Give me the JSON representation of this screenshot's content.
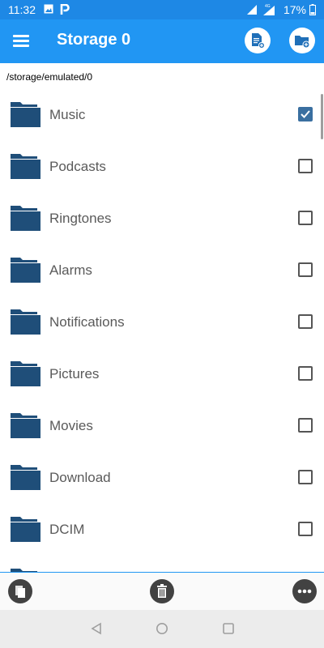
{
  "status_bar": {
    "time": "11:32",
    "battery_percent": "17%",
    "icons": [
      "image-icon",
      "p-app-icon",
      "wifi-icon",
      "cell-signal-icon",
      "battery-charging-icon"
    ]
  },
  "app_bar": {
    "title": "Storage 0",
    "menu_icon": "hamburger-icon",
    "actions": [
      "new-file-icon",
      "new-folder-icon"
    ],
    "color": "#2196f3"
  },
  "path": "/storage/emulated/0",
  "folders": [
    {
      "name": "Music",
      "checked": true
    },
    {
      "name": "Podcasts",
      "checked": false
    },
    {
      "name": "Ringtones",
      "checked": false
    },
    {
      "name": "Alarms",
      "checked": false
    },
    {
      "name": "Notifications",
      "checked": false
    },
    {
      "name": "Pictures",
      "checked": false
    },
    {
      "name": "Movies",
      "checked": false
    },
    {
      "name": "Download",
      "checked": false
    },
    {
      "name": "DCIM",
      "checked": false
    }
  ],
  "bottom_actions": [
    "copy-icon",
    "delete-icon",
    "more-icon"
  ],
  "nav_bar": [
    "back-icon",
    "home-icon",
    "recents-icon"
  ],
  "colors": {
    "folder": "#1f4e79",
    "accent": "#2196f3",
    "checkbox_checked": "#3a6fa0"
  }
}
